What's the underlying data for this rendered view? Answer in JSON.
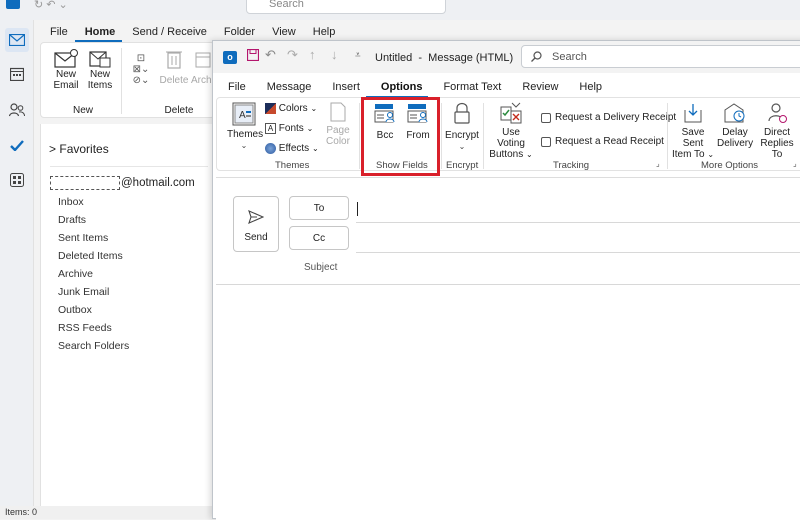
{
  "main_window": {
    "search_placeholder": "Search",
    "menu_tabs": [
      {
        "label": "File"
      },
      {
        "label": "Home",
        "active": true
      },
      {
        "label": "Send / Receive"
      },
      {
        "label": "Folder"
      },
      {
        "label": "View"
      },
      {
        "label": "Help"
      }
    ],
    "ribbon": {
      "new_email": "New\nEmail",
      "new_items": "New\nItems",
      "new_group": "New",
      "delete": "Delete",
      "archive": "Archi",
      "delete_group": "Delete"
    },
    "folder_pane": {
      "favorites": "Favorites",
      "account": "@hotmail.com",
      "folders": [
        "Inbox",
        "Drafts",
        "Sent Items",
        "Deleted Items",
        "Archive",
        "Junk Email",
        "Outbox",
        "RSS Feeds",
        "Search Folders"
      ]
    },
    "status": "Items: 0"
  },
  "message_window": {
    "title": "Untitled  -  Message (HTML)",
    "search_placeholder": "Search",
    "tabs": [
      {
        "label": "File"
      },
      {
        "label": "Message"
      },
      {
        "label": "Insert"
      },
      {
        "label": "Options",
        "active": true
      },
      {
        "label": "Format Text"
      },
      {
        "label": "Review"
      },
      {
        "label": "Help"
      }
    ],
    "ribbon": {
      "themes": {
        "themes": "Themes",
        "colors": "Colors",
        "fonts": "Fonts",
        "effects": "Effects",
        "page_color_1": "Page",
        "page_color_2": "Color",
        "group": "Themes"
      },
      "show_fields": {
        "bcc": "Bcc",
        "from": "From",
        "group": "Show Fields"
      },
      "encrypt": {
        "encrypt": "Encrypt",
        "group": "Encrypt"
      },
      "tracking": {
        "voting_1": "Use Voting",
        "voting_2": "Buttons",
        "delivery_receipt": "Request a Delivery Receipt",
        "read_receipt": "Request a Read Receipt",
        "group": "Tracking"
      },
      "more_options": {
        "save_sent_1": "Save Sent",
        "save_sent_2": "Item To",
        "delay_1": "Delay",
        "delay_2": "Delivery",
        "direct_1": "Direct",
        "direct_2": "Replies To",
        "group": "More Options"
      }
    },
    "compose": {
      "send": "Send",
      "to": "To",
      "cc": "Cc",
      "subject": "Subject"
    }
  },
  "colors": {
    "accent": "#0f6cbd",
    "highlight": "#d9202a",
    "outlook_blue": "#0f6cbd"
  }
}
